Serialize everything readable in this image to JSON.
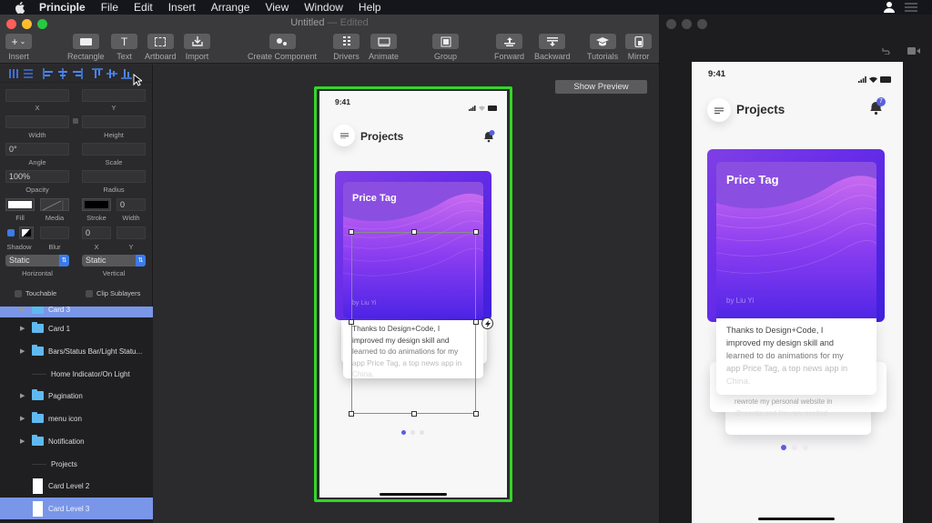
{
  "menubar": {
    "app_name": "Principle",
    "items": [
      "File",
      "Edit",
      "Insert",
      "Arrange",
      "View",
      "Window",
      "Help"
    ],
    "icons": [
      "user-icon",
      "list-icon"
    ]
  },
  "window": {
    "title": "Untitled",
    "title_suffix": "— Edited",
    "traffic_colors": {
      "close": "#fe5f57",
      "minimize": "#febc2e",
      "zoom": "#28c840"
    }
  },
  "toolbar": {
    "insert": "Insert",
    "rectangle": "Rectangle",
    "text": "Text",
    "artboard": "Artboard",
    "import": "Import",
    "create_component": "Create Component",
    "drivers": "Drivers",
    "animate": "Animate",
    "group": "Group",
    "forward": "Forward",
    "backward": "Backward",
    "tutorials": "Tutorials",
    "mirror": "Mirror"
  },
  "inspector": {
    "x": {
      "label": "X",
      "value": ""
    },
    "y": {
      "label": "Y",
      "value": ""
    },
    "width": {
      "label": "Width",
      "value": ""
    },
    "height": {
      "label": "Height",
      "value": ""
    },
    "angle": {
      "label": "Angle",
      "value": "0°"
    },
    "scale": {
      "label": "Scale",
      "value": ""
    },
    "opacity": {
      "label": "Opacity",
      "value": "100%"
    },
    "radius": {
      "label": "Radius",
      "value": ""
    },
    "fill_label": "Fill",
    "media_label": "Media",
    "stroke_label": "Stroke",
    "stroke_width": {
      "label": "Width",
      "value": "0"
    },
    "shadow_label": "Shadow",
    "blur": {
      "label": "Blur",
      "value": ""
    },
    "shadow_x": {
      "label": "X",
      "value": "0"
    },
    "shadow_y": {
      "label": "Y",
      "value": ""
    },
    "horizontal": {
      "label": "Horizontal",
      "value": "Static"
    },
    "vertical": {
      "label": "Vertical",
      "value": "Static"
    },
    "touchable": "Touchable",
    "clip_sublayers": "Clip Sublayers"
  },
  "layers": [
    {
      "name": "Card 3",
      "type": "folder",
      "selected": true
    },
    {
      "name": "Card 1",
      "type": "folder",
      "selected": false
    },
    {
      "name": "Bars/Status Bar/Light Statu...",
      "type": "folder",
      "selected": false
    },
    {
      "name": "Home Indicator/On Light",
      "type": "line",
      "selected": false
    },
    {
      "name": "Pagination",
      "type": "folder",
      "selected": false
    },
    {
      "name": "menu icon",
      "type": "folder",
      "selected": false
    },
    {
      "name": "Notification",
      "type": "folder",
      "selected": false
    },
    {
      "name": "Projects",
      "type": "line",
      "selected": false
    },
    {
      "name": "Card Level 2",
      "type": "rect",
      "selected": false
    },
    {
      "name": "Card Level 3",
      "type": "rect",
      "selected": true
    }
  ],
  "canvas": {
    "show_preview": "Show Preview",
    "artboard_highlight": "#33d62a"
  },
  "phone": {
    "time": "9:41",
    "title": "Projects",
    "notification_count": "7",
    "card_title": "Price Tag",
    "byline": "by Liu Yi",
    "body_lines": [
      "Thanks to Design+Code, I",
      "improved my design skill and",
      "learned to do animations for my",
      "app Price Tag, a top news app in",
      "China."
    ],
    "under_lines": [
      "rewrote my personal website in",
      "@reactjs and I'm very excited"
    ],
    "pagination": {
      "current": 1,
      "total": 3
    },
    "accent": "#5a5ee0"
  }
}
